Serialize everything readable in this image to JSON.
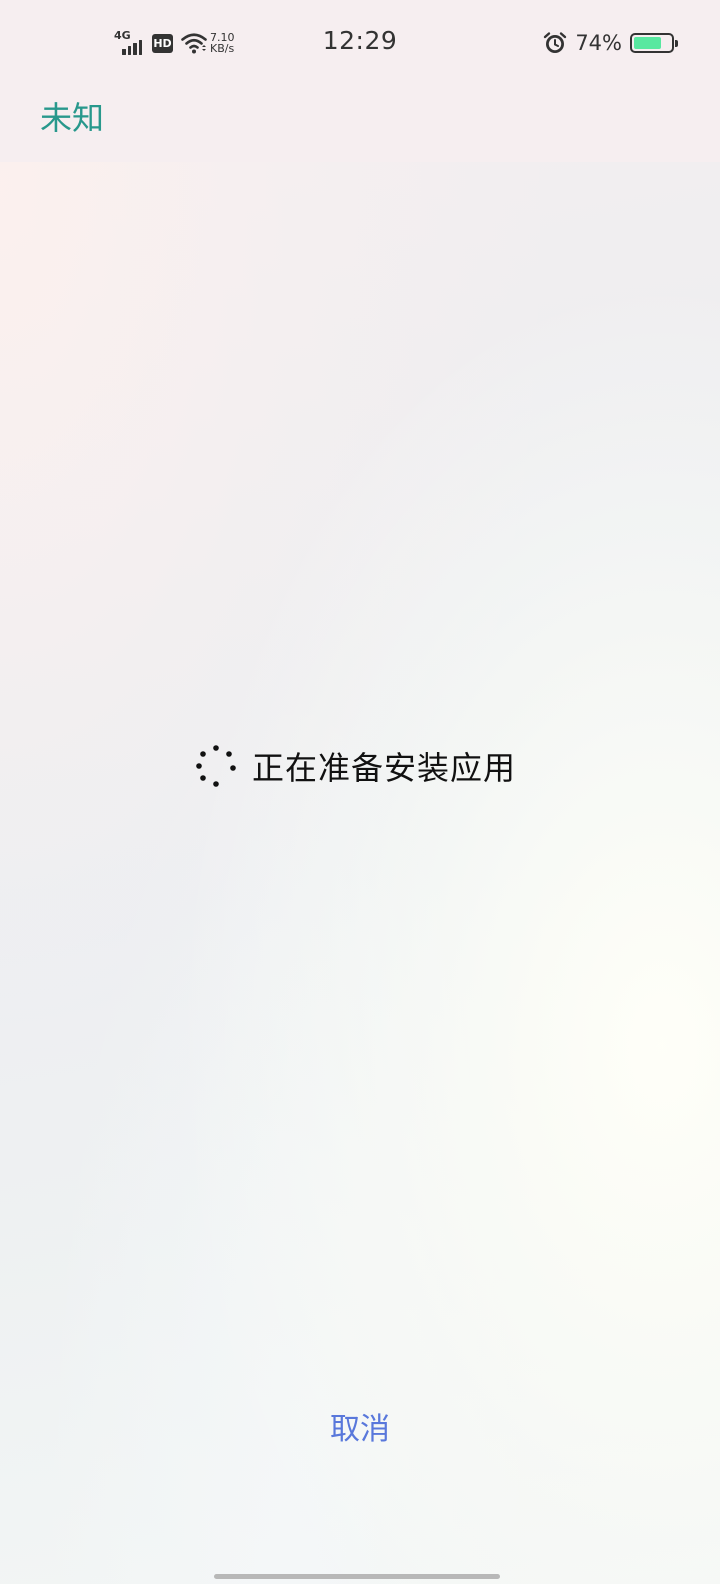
{
  "status_bar": {
    "network_type": "4G",
    "hd_label": "HD",
    "net_speed_value": "7.10",
    "net_speed_unit": "KB/s",
    "time": "12:29",
    "battery_percent_text": "74%",
    "battery_level": 0.74,
    "battery_color": "#58e8a0",
    "icons": [
      "signal-icon",
      "hd-icon",
      "wifi-icon",
      "alarm-icon",
      "battery-icon"
    ]
  },
  "app_bar": {
    "title": "未知",
    "title_color": "#28988c"
  },
  "main": {
    "loading_icon": "spinner-icon",
    "loading_text": "正在准备安装应用"
  },
  "footer": {
    "cancel_label": "取消",
    "cancel_color": "#5978db"
  }
}
